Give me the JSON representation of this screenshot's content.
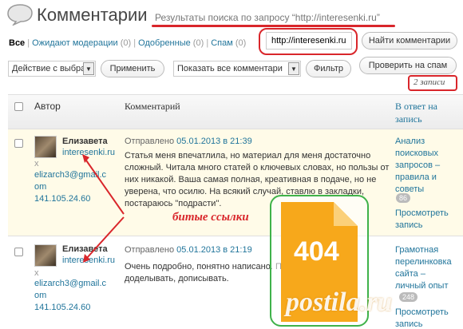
{
  "page": {
    "title": "Комментарии",
    "search_subtitle": "Результаты поиска по запросу “http://interesenki.ru”"
  },
  "filters": [
    {
      "label": "Все",
      "count": ""
    },
    {
      "label": "Ожидают модерации",
      "count": "(0)"
    },
    {
      "label": "Одобренные",
      "count": "(0)"
    },
    {
      "label": "Спам",
      "count": "(0)"
    }
  ],
  "filter_seps": [
    "|",
    "|",
    "|"
  ],
  "search": {
    "value": "http://interesenki.ru",
    "button": "Найти комментарии"
  },
  "bulk": {
    "selected": "Действие с выбра",
    "apply": "Применить"
  },
  "view": {
    "selected": "Показать все комментари",
    "filter": "Фильтр"
  },
  "spam_button": "Проверить на спам",
  "items_count": "2 записи",
  "columns": {
    "author": "Автор",
    "comment": "Комментарий",
    "response_line1": "В ответ на",
    "response_line2": "запись"
  },
  "rows": [
    {
      "author_name": "Елизавета",
      "author_site": "interesenki.ru",
      "email_prefix": "x",
      "email_line1": "elizarch3@gmail.c",
      "email_line2": "om",
      "ip": "141.105.24.60",
      "submitted_prefix": "Отправлено",
      "submitted_date": "05.01.2013 в 21:39",
      "comment_lines": [
        "Статья меня впечатлила, но материал для меня достаточно",
        "сложный. Читала много статей о ключевых словах, но пользы от",
        "них никакой. Ваша самая полная, креативная в подаче, но не",
        "уверена, что осилю. На всякий случай, ставлю в закладки,",
        "постараюсь \"подрасти\"."
      ],
      "response_lines": [
        "Анализ",
        "поисковых",
        "запросов –",
        "правила и",
        "советы"
      ],
      "response_count": "86",
      "view_post": [
        "Просмотреть",
        "запись"
      ]
    },
    {
      "author_name": "Елизавета",
      "author_site": "interesenki.ru",
      "email_prefix": "x",
      "email_line1": "elizarch3@gmail.c",
      "email_line2": "om",
      "ip": "141.105.24.60",
      "submitted_prefix": "Отправлено",
      "submitted_date": "05.01.2013 в 21:19",
      "comment_lines": [
        "Очень подробно, понятно написано. Пр",
        "доделывать, дописывать."
      ],
      "response_lines": [
        "Грамотная",
        "перелинковка",
        "сайта –",
        "личный опыт"
      ],
      "response_count": "248",
      "view_post": [
        "Просмотреть",
        "запись"
      ]
    }
  ],
  "annotation": {
    "broken_links": "битые ссылки",
    "error_code": "404",
    "watermark": "postila.ru"
  },
  "colors": {
    "link": "#21759b",
    "annotation_red": "#d9262b",
    "green_frame": "#3fb24a",
    "doc_orange": "#f7a81b"
  }
}
